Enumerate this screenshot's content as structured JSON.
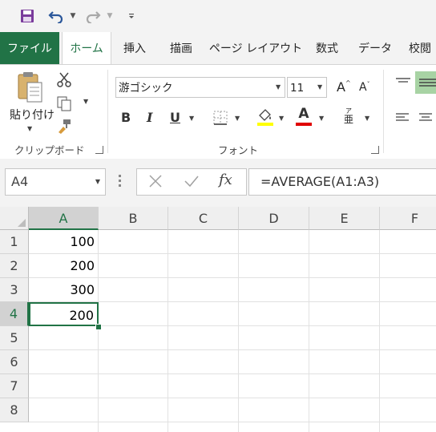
{
  "colors": {
    "excel_green": "#217346",
    "font_color_red": "#e00000",
    "highlight_yellow": "#ffff00",
    "ribbon_bg": "#ffffff",
    "chrome_bg": "#f3f3f3"
  },
  "qat": {
    "save": "save-icon",
    "undo": "undo-icon",
    "redo": "redo-icon",
    "customize": "customize-icon"
  },
  "tabs": [
    {
      "label": "ファイル"
    },
    {
      "label": "ホーム"
    },
    {
      "label": "挿入"
    },
    {
      "label": "描画"
    },
    {
      "label": "ページ レイアウト"
    },
    {
      "label": "数式"
    },
    {
      "label": "データ"
    },
    {
      "label": "校閲"
    }
  ],
  "clipboard": {
    "paste_label": "貼り付け",
    "group_label": "クリップボード"
  },
  "font": {
    "name": "游ゴシック",
    "size": "11",
    "group_label": "フォント",
    "bold": "B",
    "italic": "I",
    "underline": "U",
    "increase": "A",
    "decrease": "A",
    "font_color_letter": "A",
    "phonetic_top": "ア",
    "phonetic_bottom": "亜"
  },
  "formula_bar": {
    "name_box": "A4",
    "fx": "fx",
    "formula": "=AVERAGE(A1:A3)"
  },
  "sheet": {
    "columns": [
      "A",
      "B",
      "C",
      "D",
      "E",
      "F"
    ],
    "rows": [
      "1",
      "2",
      "3",
      "4",
      "5",
      "6",
      "7",
      "8"
    ],
    "cells": {
      "A1": "100",
      "A2": "200",
      "A3": "300",
      "A4": "200"
    },
    "active_cell": "A4"
  }
}
